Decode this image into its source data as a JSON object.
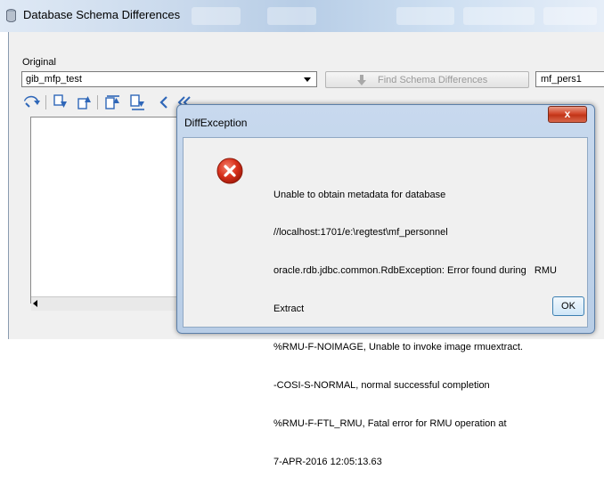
{
  "window": {
    "title": "Database Schema Differences",
    "icon": "database-icon"
  },
  "form": {
    "original_label": "Original",
    "original_value": "gib_mfp_test",
    "find_button_label": "Find Schema Differences",
    "find_button_icon": "down-arrow-icon",
    "target_value": "mf_pers1"
  },
  "toolbar": {
    "icons": [
      "undo-icon",
      "copy-down-icon",
      "copy-up-icon",
      "copy-all-up-icon",
      "copy-all-down-icon",
      "prev-icon",
      "first-icon"
    ]
  },
  "dialog": {
    "title": "DiffException",
    "close_label": "x",
    "icon": "error-icon",
    "message_lines": [
      "Unable to obtain metadata for database",
      "//localhost:1701/e:\\regtest\\mf_personnel",
      "oracle.rdb.jdbc.common.RdbException: Error found during   RMU",
      "Extract",
      "%RMU-F-NOIMAGE, Unable to invoke image rmuextract.",
      "-COSI-S-NORMAL, normal successful completion",
      "%RMU-F-FTL_RMU, Fatal error for RMU operation at",
      "7-APR-2016 12:05:13.63"
    ],
    "ok_label": "OK"
  },
  "colors": {
    "error_red": "#d8301c",
    "close_red": "#c13417",
    "dialog_frame": "#b8cde6",
    "window_bg": "#f0f0f0"
  }
}
